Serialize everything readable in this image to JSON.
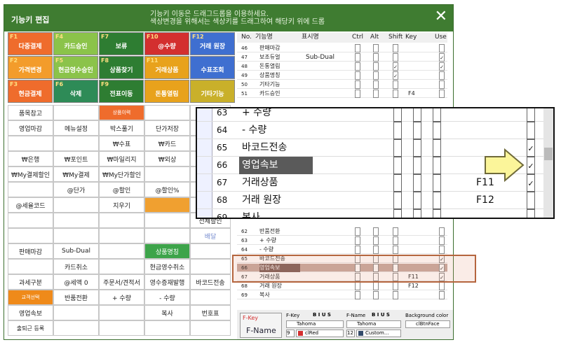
{
  "title": "기능키 편집",
  "hint1": "기능키 이동은 드래그드롭을 이용하세요.",
  "hint2": "색상변경을 위해서는 색상키를 드래그하여 해당키 위에 드롭",
  "fkeys": [
    {
      "k": "F1",
      "l": "다중결제",
      "c": "#ef6c2c"
    },
    {
      "k": "F4",
      "l": "카드승인",
      "c": "#8bc34a"
    },
    {
      "k": "F7",
      "l": "보류",
      "c": "#2e7d32"
    },
    {
      "k": "F10",
      "l": "@수량",
      "c": "#d32f2f"
    },
    {
      "k": "F12",
      "l": "거래 원장",
      "c": "#3f6fd0"
    },
    {
      "k": "F2",
      "l": "가격변경",
      "c": "#f39c2b"
    },
    {
      "k": "F5",
      "l": "현금영수승인",
      "c": "#8bc34a"
    },
    {
      "k": "F8",
      "l": "상품찾기",
      "c": "#2e7d32"
    },
    {
      "k": "F11",
      "l": "거래상품",
      "c": "#e8a21c"
    },
    {
      "k": "",
      "l": "수표조회",
      "c": "#3f6fd0"
    },
    {
      "k": "F3",
      "l": "현금결제",
      "c": "#ef6c2c"
    },
    {
      "k": "F6",
      "l": "삭제",
      "c": "#2e8b57"
    },
    {
      "k": "F9",
      "l": "전표이동",
      "c": "#2e7d32"
    },
    {
      "k": "",
      "l": "돈통열림",
      "c": "#e8a21c"
    },
    {
      "k": "",
      "l": "기타기능",
      "c": "#c9b02a"
    }
  ],
  "cells": [
    "품목참고",
    "",
    "상품이력",
    "",
    "",
    "영업마감",
    "메뉴설정",
    "박스풀기",
    "단가저장",
    "",
    "",
    "",
    "₩수표",
    "₩카드",
    "",
    "₩은행",
    "₩포인트",
    "₩마일리지",
    "₩외상",
    "",
    "₩My결제할인",
    "₩My결제",
    "₩My단가할인",
    "",
    "",
    "",
    "@단가",
    "@할인",
    "@할인%",
    "",
    "@세율코드",
    "",
    "지우기",
    "",
    "",
    "",
    "",
    "",
    "",
    "전체할인",
    "",
    "",
    "",
    "",
    "배달",
    "판매마감",
    "Sub-Dual",
    "",
    "상품명칭",
    "",
    "",
    "카드취소",
    "",
    "현금영수취소",
    "",
    "과세구분",
    "@세액 0",
    "주문서/견적서",
    "영수증재발행",
    "바코드전송",
    "교객선택",
    "반품전환",
    "+ 수량",
    "- 수량",
    "",
    "영업속보",
    "",
    "",
    "복사",
    "번호표",
    "출퇴근 등록",
    "",
    "",
    "",
    ""
  ],
  "grid_header": {
    "no": "No.",
    "name": "기능명",
    "disp": "표시명",
    "ctrl": "Ctrl",
    "alt": "Alt",
    "shift": "Shift",
    "key": "Key",
    "use": "Use"
  },
  "grid_rows": [
    {
      "no": "46",
      "name": "판매마감",
      "disp": "",
      "s": false,
      "key": "",
      "u": false
    },
    {
      "no": "47",
      "name": "보조듀얼",
      "disp": "Sub-Dual",
      "s": false,
      "key": "",
      "u": true
    },
    {
      "no": "48",
      "name": "돈통열림",
      "disp": "",
      "s": true,
      "key": "",
      "u": true
    },
    {
      "no": "49",
      "name": "상품명칭",
      "disp": "",
      "s": true,
      "key": "",
      "u": false
    },
    {
      "no": "50",
      "name": "기타기능",
      "disp": "",
      "s": false,
      "key": "",
      "u": false
    },
    {
      "no": "51",
      "name": "카드승인",
      "disp": "",
      "s": false,
      "key": "F4",
      "u": false
    }
  ],
  "grid_rows2": [
    {
      "no": "62",
      "name": "반품전환",
      "disp": "",
      "s": false,
      "key": "",
      "u": false
    },
    {
      "no": "63",
      "name": "+ 수량",
      "disp": "",
      "s": false,
      "key": "",
      "u": false
    },
    {
      "no": "64",
      "name": "- 수량",
      "disp": "",
      "s": false,
      "key": "",
      "u": false
    },
    {
      "no": "65",
      "name": "바코드전송",
      "disp": "",
      "s": false,
      "key": "",
      "u": true
    },
    {
      "no": "66",
      "name": "영업속보",
      "disp": "",
      "s": false,
      "key": "",
      "u": true
    },
    {
      "no": "67",
      "name": "거래상품",
      "disp": "",
      "s": false,
      "key": "F11",
      "u": true
    },
    {
      "no": "68",
      "name": "거래 원장",
      "disp": "",
      "s": false,
      "key": "F12",
      "u": false
    },
    {
      "no": "69",
      "name": "복사",
      "disp": "",
      "s": false,
      "key": "",
      "u": false
    }
  ],
  "zoom_rows": [
    {
      "no": "63",
      "name": "+ 수량",
      "key": "",
      "u": false
    },
    {
      "no": "64",
      "name": "- 수량",
      "key": "",
      "u": false
    },
    {
      "no": "65",
      "name": "바코드전송",
      "key": "",
      "u": true
    },
    {
      "no": "66",
      "name": "영업속보",
      "key": "",
      "u": true
    },
    {
      "no": "67",
      "name": "거래상품",
      "key": "F11",
      "u": true
    },
    {
      "no": "68",
      "name": "거래 원장",
      "key": "F12",
      "u": false
    },
    {
      "no": "69",
      "name": "복사",
      "key": "",
      "u": false
    }
  ],
  "bottom": {
    "fkey_label": "F-Key",
    "fname_label": "F-Name",
    "fkey_hdr": "F-Key",
    "fname_hdr": "F-Name",
    "bg_hdr": "Background color",
    "font1": "Tahoma",
    "font2": "Tahoma",
    "size1": "9",
    "size2": "12",
    "color1": "clRed",
    "color2": "Custom...",
    "bg": "clBtnFace"
  }
}
